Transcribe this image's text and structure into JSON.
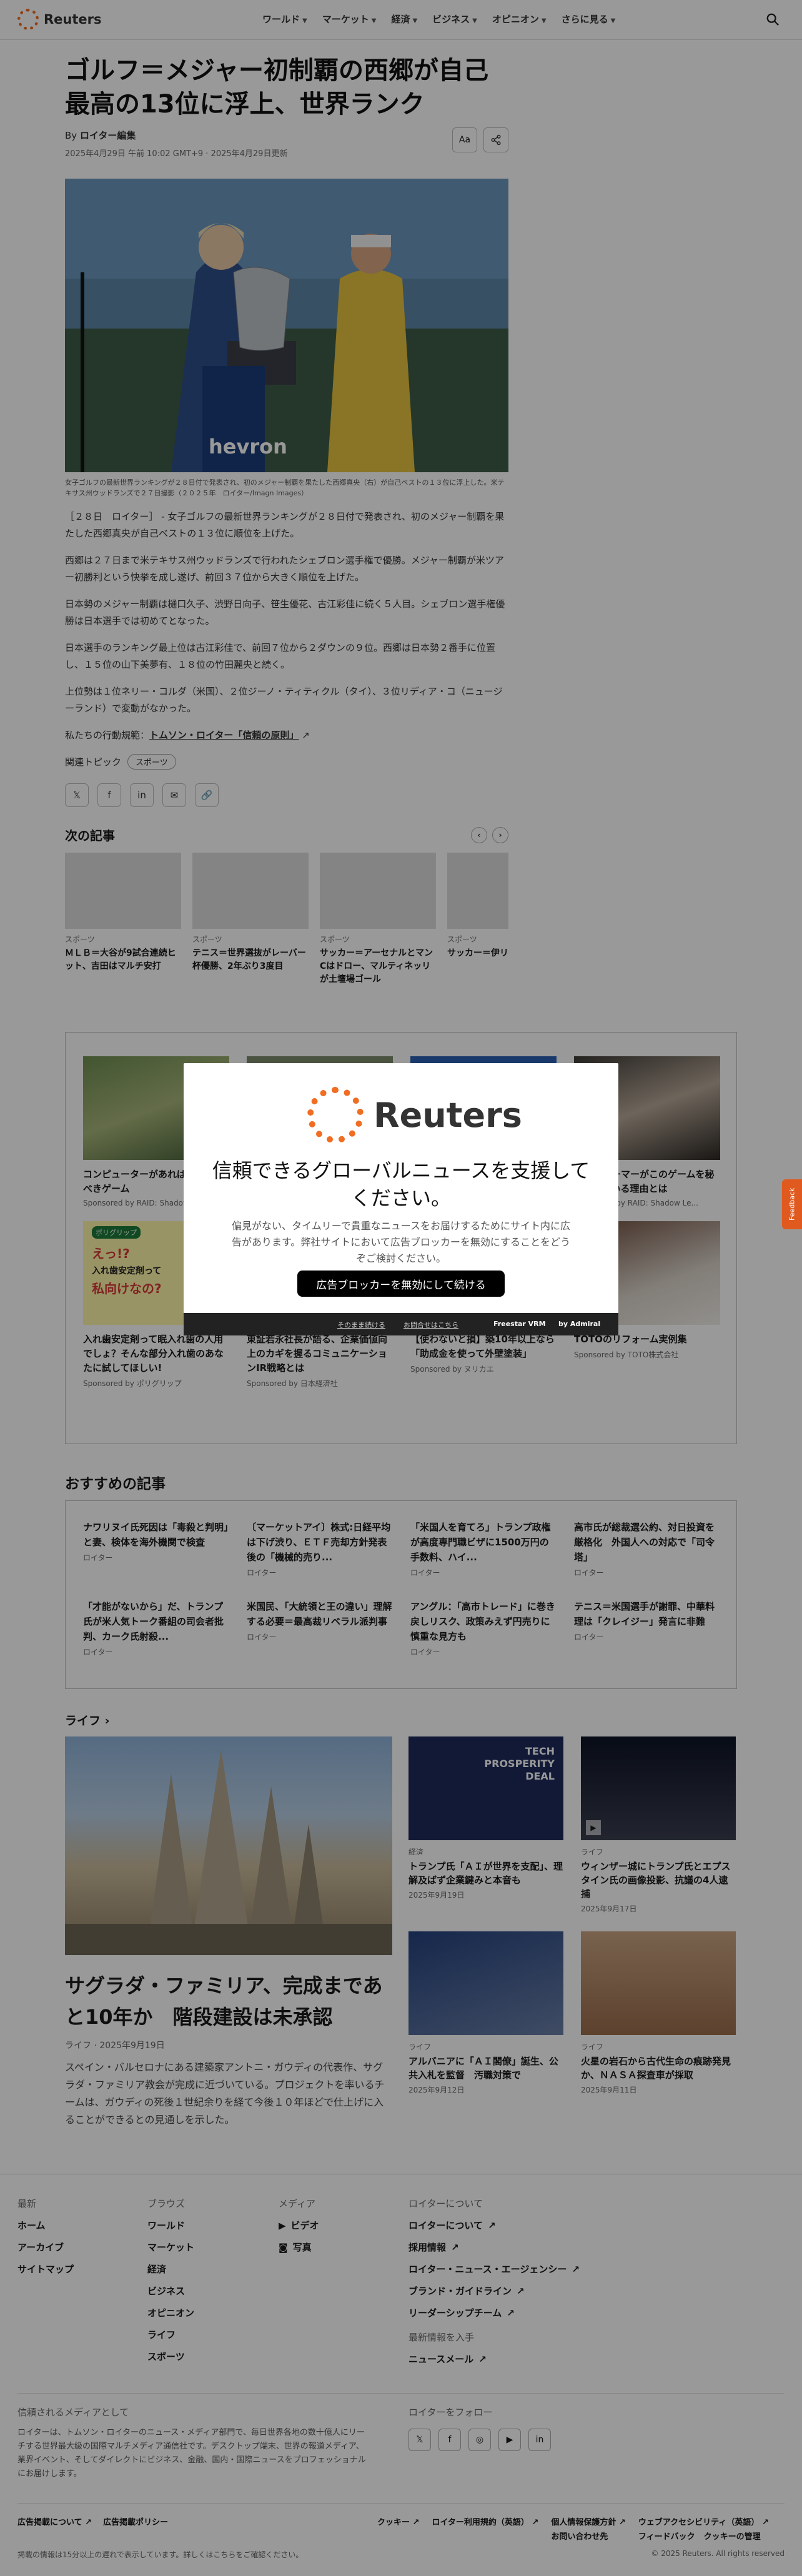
{
  "header": {
    "logo": "Reuters",
    "nav": [
      "ワールド",
      "マーケット",
      "経済",
      "ビジネス",
      "オピニオン",
      "さらに見る"
    ]
  },
  "article": {
    "title": "ゴルフ＝メジャー初制覇の西郷が自己最高の13位に浮上、世界ランク",
    "byline_prefix": "By",
    "byline_author": "ロイター編集",
    "dateline": "2025年4月29日 午前 10:02 GMT+9 · 2025年4月29日更新",
    "font_button": "Aa",
    "caption": "女子ゴルフの最新世界ランキングが２８日付で発表され、初のメジャー制覇を果たした西郷真央（右）が自己ベストの１３位に浮上した。米テキサス州ウッドランズで２７日撮影（２０２５年　ロイター/Imagn Images）",
    "paragraphs": [
      "［２８日　ロイター］ - 女子ゴルフの最新世界ランキングが２８日付で発表され、初のメジャー制覇を果たした西郷真央が自己ベストの１３位に順位を上げた。",
      "西郷は２７日まで米テキサス州ウッドランズで行われたシェブロン選手権で優勝。メジャー制覇が米ツアー初勝利という快挙を成し遂げ、前回３７位から大きく順位を上げた。",
      "日本勢のメジャー制覇は樋口久子、渋野日向子、笹生優花、古江彩佳に続く５人目。シェブロン選手権優勝は日本選手では初めてとなった。",
      "日本選手のランキング最上位は古江彩佳で、前回７位から２ダウンの９位。西郷は日本勢２番手に位置し、１５位の山下美夢有、１８位の竹田麗央と続く。",
      "上位勢は１位ネリー・コルダ（米国）、２位ジーノ・ティティクル（タイ）、３位リディア・コ（ニュージーランド）で変動がなかった。"
    ],
    "principles_prefix": "私たちの行動規範：",
    "principles_link": "トムソン・ロイター「信頼の原則」",
    "related_label": "関連トピック",
    "related_chip": "スポーツ",
    "next_title": "次の記事",
    "next": [
      {
        "cat": "スポーツ",
        "title": "ＭＬＢ＝大谷が9試合連続ヒット、吉田はマルチ安打"
      },
      {
        "cat": "スポーツ",
        "title": "テニス＝世界選抜がレーバー杯優勝、2年ぶり3度目"
      },
      {
        "cat": "スポーツ",
        "title": "サッカー＝アーセナルとマンCはドロー、マルティネッリが土壇場ゴール"
      },
      {
        "cat": "スポーツ",
        "title": "サッカー＝伊リーグ、ナポリがジェノアに勝利し首位"
      }
    ]
  },
  "sponsored": [
    {
      "title": "コンピューターがあれば絶対試すべきゲーム",
      "by": "Sponsored by RAID: Shadow Legends"
    },
    {
      "title": "",
      "by": ""
    },
    {
      "title": "",
      "by": ""
    },
    {
      "title": "多くのゲーマーがこのゲームを秘密にしている理由とは",
      "by": "Sponsored by RAID: Shadow Le..."
    },
    {
      "title": "入れ歯安定剤って眠入れ歯の人用でしょ？そんな部分入れ歯のあなたに試してほしい!",
      "by": "Sponsored by ポリグリップ"
    },
    {
      "title": "東証若永社長が語る、企業価値向上のカギを握るコミュニケーションIR戦略とは",
      "by": "Sponsored by 日本経済社"
    },
    {
      "title": "【使わないと損】築10年以上なら「助成金を使って外壁塗装」",
      "by": "Sponsored by ヌリカエ"
    },
    {
      "title": "TOTOのリフォーム実例集",
      "by": "Sponsored by TOTO株式会社"
    }
  ],
  "sponsored_banner": {
    "line1": "えっ!?",
    "line2": "入れ歯安定剤って",
    "line3": "私向けなの?",
    "brand": "ポリグリップ"
  },
  "recommended": {
    "title": "おすすめの記事",
    "items": [
      {
        "title": "ナワリヌイ氏死因は「毒殺と判明」と妻、検体を海外機関で検査",
        "by": "ロイター"
      },
      {
        "title": "〔マーケットアイ〕株式:日経平均は下げ渋り、ＥＴＦ売却方針発表後の「機械的売り...",
        "by": "ロイター"
      },
      {
        "title": "「米国人を育てろ」トランプ政権が高度専門職ビザに1500万円の手数料、ハイ...",
        "by": "ロイター"
      },
      {
        "title": "高市氏が総裁選公約、対日投資を厳格化　外国人への対応で「司令塔」",
        "by": "ロイター"
      },
      {
        "title": "「才能がないから」だ、トランプ氏が米人気トーク番組の司会者批判、カーク氏射殺...",
        "by": "ロイター"
      },
      {
        "title": "米国民、「大統領と王の違い」理解する必要＝最高裁リベラル派判事",
        "by": "ロイター"
      },
      {
        "title": "アングル：「高市トレード」に巻き戻しリスク、政策みえず円売りに慎重な見方も",
        "by": "ロイター"
      },
      {
        "title": "テニス＝米国選手が謝罪、中華料理は「クレイジー」発言に非難",
        "by": "ロイター"
      }
    ]
  },
  "life": {
    "title": "ライフ",
    "main": {
      "title": "サグラダ・ファミリア、完成まであと10年か　階段建設は未承認",
      "meta": "ライフ · 2025年9月19日",
      "desc": "スペイン・バルセロナにある建築家アントニ・ガウディの代表作、サグラダ・ファミリア教会が完成に近づいている。プロジェクトを率いるチームは、ガウディの死後１世紀余りを経て今後１０年ほどで仕上げに入ることができるとの見通しを示した。"
    },
    "side": [
      {
        "cat": "経済",
        "title": "トランプ氏「ＡＩが世界を支配」、理解及ばず企業鍵みと本音も",
        "date": "2025年9月19日",
        "img_text1": "TECH",
        "img_text2": "PROSPERITY",
        "img_text3": "DEAL"
      },
      {
        "cat": "ライフ",
        "title": "ウィンザー城にトランプ氏とエプスタイン氏の画像投影、抗議の4人逮捕",
        "date": "2025年9月17日"
      },
      {
        "cat": "ライフ",
        "title": "アルバニアに「ＡＩ閣僚」誕生、公共入札を監督　汚職対策で",
        "date": "2025年9月12日"
      },
      {
        "cat": "ライフ",
        "title": "火星の岩石から古代生命の痕跡発見か、ＮＡＳＡ探査車が採取",
        "date": "2025年9月11日"
      }
    ]
  },
  "footer": {
    "col1": {
      "head": "最新",
      "items": [
        "ホーム",
        "アーカイブ",
        "サイトマップ"
      ]
    },
    "col2": {
      "head": "ブラウズ",
      "items": [
        "ワールド",
        "マーケット",
        "経済",
        "ビジネス",
        "オピニオン",
        "ライフ",
        "スポーツ"
      ]
    },
    "col3": {
      "head": "メディア",
      "items": [
        "ビデオ",
        "写真"
      ]
    },
    "col4": {
      "head": "ロイターについて",
      "items": [
        "ロイターについて",
        "採用情報",
        "ロイター・ニュース・エージェンシー",
        "ブランド・ガイドライン",
        "リーダーシップチーム"
      ]
    },
    "col5": {
      "head": "最新情報を入手",
      "items": [
        "ニュースメール"
      ]
    },
    "trust_head": "信頼されるメディアとして",
    "trust_text": "ロイターは、トムソン・ロイターのニュース・メディア部門で、毎日世界各地の数十億人にリーチする世界最大級の国際マルチメディア通信社です。デスクトップ端末、世界の報道メディア、業界イベント、そしてダイレクトにビジネス、金融、国内・国際ニュースをプロフェッショナルにお届けします。",
    "follow_head": "ロイターをフォロー",
    "legal_left": [
      "広告掲載について",
      "広告掲載ポリシー"
    ],
    "legal_right": [
      "クッキー",
      "ロイター利用規約（英語）",
      "個人情報保護方針",
      "ウェブアクセシビリティ（英語）"
    ],
    "legal_right2": [
      "お問い合わせ先",
      "フィードバック",
      "クッキーの管理"
    ],
    "note": "掲載の情報は15分以上の遅れで表示しています。詳しくはこちらをご確認ください。",
    "copyright": "© 2025 Reuters. All rights reserved"
  },
  "modal": {
    "logo": "Reuters",
    "title": "信頼できるグローバルニュースを支援してください。",
    "desc": "偏見がない、タイムリーで貴重なニュースをお届けするためにサイト内に広告があります。弊社サイトにおいて広告ブロッカーを無効にすることをどうぞご検討ください。",
    "button": "広告ブロッカーを無効にして続ける",
    "link1": "そのまま続ける",
    "link2": "お問合せはこちら",
    "brand": "Freestar VRM",
    "by": "by Admiral"
  },
  "feedback": "Feedback"
}
